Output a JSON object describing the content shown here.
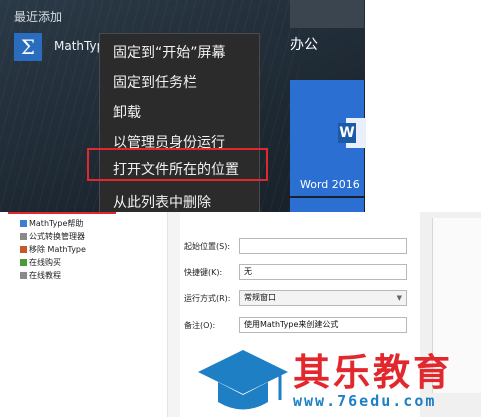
{
  "start_menu": {
    "recent_title": "最近添加",
    "recent_app": {
      "name": "MathType",
      "icon": "sigma-icon",
      "icon_glyph": "Σ"
    },
    "group_title": "办公",
    "word_tile": {
      "label": "Word 2016",
      "icon": "word-icon",
      "icon_glyph": "W",
      "color": "#2a6fd1"
    }
  },
  "context_menu": {
    "items": [
      {
        "label": "固定到“开始”屏幕"
      },
      {
        "label": "固定到任务栏"
      },
      {
        "label": "卸载"
      },
      {
        "label": "以管理员身份运行"
      },
      {
        "label": "打开文件所在的位置",
        "highlighted": true
      },
      {
        "label": "从此列表中删除"
      }
    ],
    "highlight_color": "#e2272d"
  },
  "file_tree": {
    "items": [
      {
        "label": "MathType帮助",
        "icon": "help-doc-icon"
      },
      {
        "label": "公式转换管理器",
        "icon": "converter-icon"
      },
      {
        "label": "移除 MathType",
        "icon": "uninstall-icon"
      },
      {
        "label": "在线购买",
        "icon": "shopping-icon"
      },
      {
        "label": "在线教程",
        "icon": "tutorial-icon"
      }
    ]
  },
  "properties": {
    "start_in_label": "起始位置(S):",
    "start_in_value": "",
    "hotkey_label": "快捷键(K):",
    "hotkey_value": "无",
    "run_label": "运行方式(R):",
    "run_value": "常规窗口",
    "comment_label": "备注(O):",
    "comment_value": "使用MathType来创建公式"
  },
  "watermark": {
    "brand": "其乐教育",
    "url": "www.76edu.com",
    "brand_color": "#e2272d",
    "cap_color": "#1e7fc4"
  }
}
